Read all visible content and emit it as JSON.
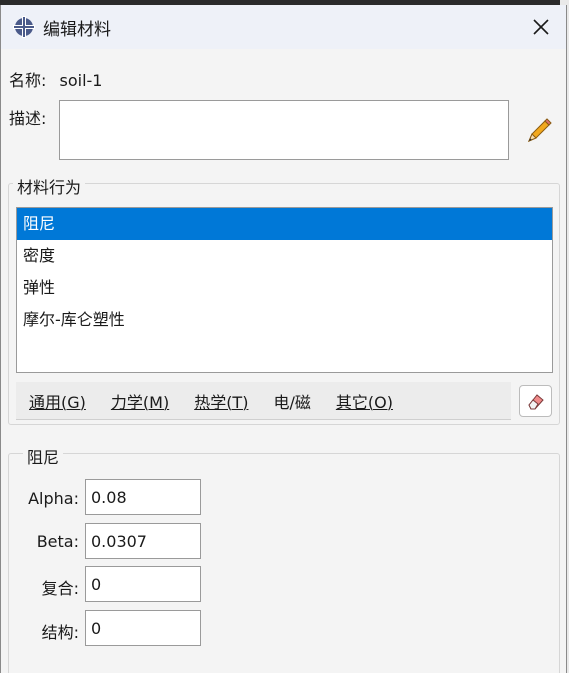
{
  "window": {
    "title": "编辑材料"
  },
  "name": {
    "label": "名称:",
    "value": "soil-1"
  },
  "description": {
    "label": "描述:",
    "value": ""
  },
  "behaviors": {
    "group_title": "材料行为",
    "items": [
      "阻尼",
      "密度",
      "弹性",
      "摩尔-库仑塑性"
    ],
    "selected_index": 0
  },
  "menu": {
    "items": [
      "通用(G)",
      "力学(M)",
      "热学(T)",
      "电/磁",
      "其它(O)"
    ]
  },
  "damping": {
    "group_title": "阻尼",
    "fields": [
      {
        "label": "Alpha:",
        "value": "0.08"
      },
      {
        "label": "Beta:",
        "value": "0.0307"
      },
      {
        "label": "复合:",
        "value": "0"
      },
      {
        "label": "结构:",
        "value": "0"
      }
    ]
  },
  "colors": {
    "selection": "#0078d7",
    "titlebar": "#eef1f8",
    "panel": "#f4f4f4"
  },
  "icons": [
    "app-icon",
    "close-icon",
    "pencil-icon",
    "eraser-icon"
  ]
}
